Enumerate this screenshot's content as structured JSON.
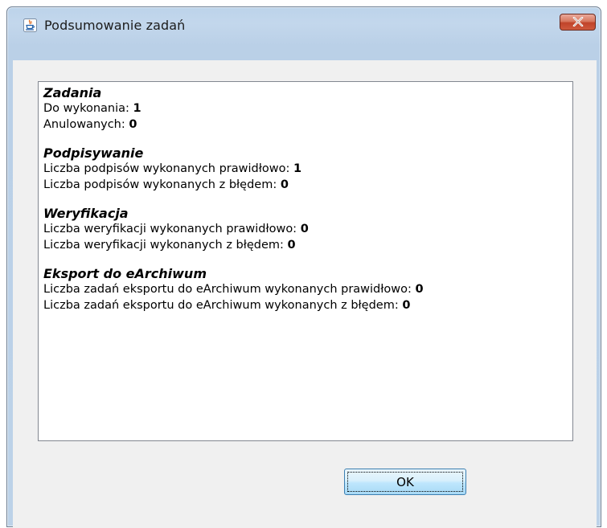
{
  "window": {
    "title": "Podsumowanie zadań",
    "app_icon": "java-cup-icon",
    "close_icon": "close-icon"
  },
  "sections": [
    {
      "title": "Zadania",
      "rows": [
        {
          "label": "Do wykonania:",
          "value": "1"
        },
        {
          "label": "Anulowanych:",
          "value": "0"
        }
      ]
    },
    {
      "title": "Podpisywanie",
      "rows": [
        {
          "label": "Liczba podpisów wykonanych prawidłowo:",
          "value": "1"
        },
        {
          "label": "Liczba podpisów wykonanych z błędem:",
          "value": "0"
        }
      ]
    },
    {
      "title": "Weryfikacja",
      "rows": [
        {
          "label": "Liczba weryfikacji wykonanych prawidłowo:",
          "value": "0"
        },
        {
          "label": "Liczba weryfikacji wykonanych z błędem:",
          "value": "0"
        }
      ]
    },
    {
      "title": "Eksport do eArchiwum",
      "rows": [
        {
          "label": "Liczba zadań eksportu do eArchiwum wykonanych prawidłowo:",
          "value": "0"
        },
        {
          "label": "Liczba zadań eksportu do eArchiwum wykonanych z błędem:",
          "value": "0"
        }
      ]
    }
  ],
  "buttons": {
    "ok_label": "OK"
  },
  "colors": {
    "frame": "#bcd3ea",
    "close_button": "#c7472d",
    "ok_button": "#bee6fd"
  }
}
